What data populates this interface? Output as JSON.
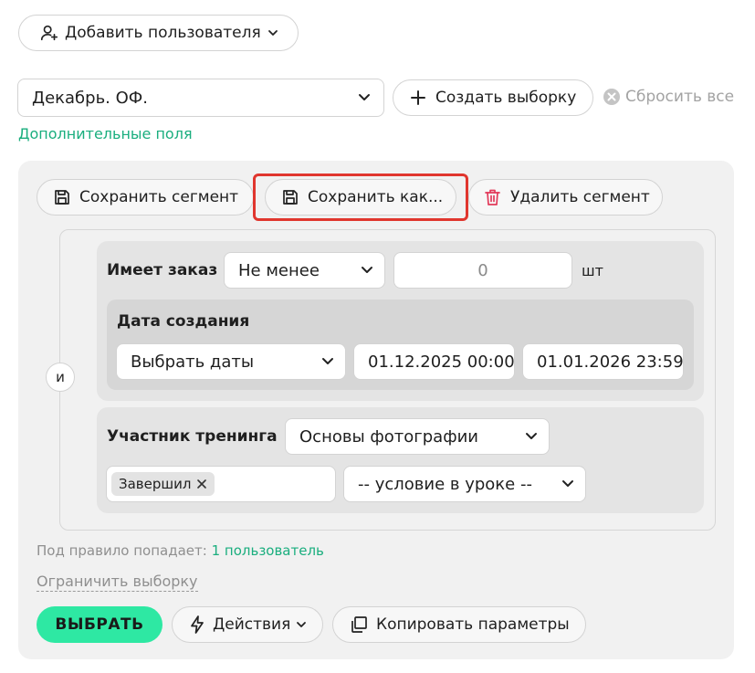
{
  "header": {
    "add_user_label": "Добавить пользователя"
  },
  "segment_select": {
    "value": "Декабрь. ОФ."
  },
  "create_selection_label": "Создать выборку",
  "reset_all_label": "Сбросить все",
  "additional_fields_label": "Дополнительные поля",
  "segment_actions": {
    "save_label": "Сохранить сегмент",
    "save_as_label": "Сохранить как...",
    "delete_label": "Удалить сегмент"
  },
  "logic_operator": "и",
  "has_order": {
    "label": "Имеет заказ",
    "condition": "Не менее",
    "value": "0",
    "unit": "шт"
  },
  "creation_date": {
    "label": "Дата создания",
    "mode": "Выбрать даты",
    "from": "01.12.2025 00:00",
    "to": "01.01.2026 23:59"
  },
  "training": {
    "label": "Участник тренинга",
    "course": "Основы фотографии",
    "tag": "Завершил",
    "lesson_condition": "-- условие в уроке --"
  },
  "result": {
    "prefix": "Под правило попадает:",
    "count": "1 пользователь"
  },
  "limit_label": "Ограничить выборку",
  "footer": {
    "select_label": "ВЫБРАТЬ",
    "actions_label": "Действия",
    "copy_label": "Копировать параметры"
  },
  "colors": {
    "accent": "#2ee8a3",
    "link": "#1aae7e",
    "highlight": "#e0362e",
    "danger_icon": "#e23a5a"
  }
}
